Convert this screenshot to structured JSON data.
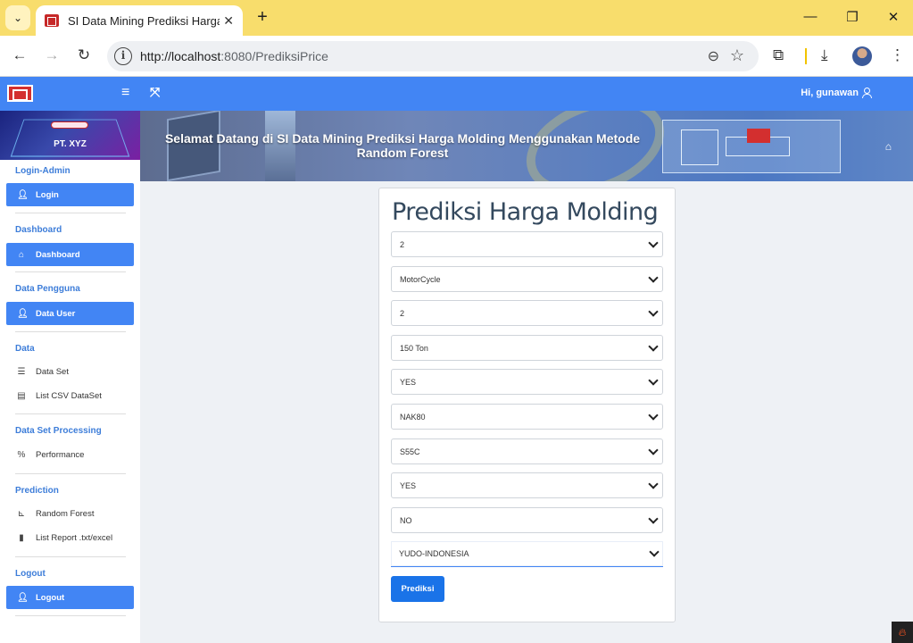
{
  "browser": {
    "tab_title": "SI Data Mining Prediksi Harga M",
    "tab_close": "✕",
    "new_tab": "+",
    "url_host": "http://localhost",
    "url_rest": ":8080/PrediksiPrice",
    "window_minimize": "—",
    "window_restore": "❐",
    "window_close": "✕"
  },
  "app": {
    "user_greeting": "Hi, gunawan",
    "company_name": "PT. XYZ",
    "hero_title": "Selamat Datang di SI Data Mining Prediksi Harga Molding Menggunakan Metode Random Forest"
  },
  "sidebar": {
    "sections": {
      "login_admin": "Login-Admin",
      "dashboard": "Dashboard",
      "data_pengguna": "Data Pengguna",
      "data": "Data",
      "processing": "Data Set Processing",
      "prediction": "Prediction",
      "logout": "Logout"
    },
    "items": {
      "login": "Login",
      "dashboard": "Dashboard",
      "data_user": "Data User",
      "data_set": "Data Set",
      "list_csv": "List CSV DataSet",
      "performance": "Performance",
      "random_forest": "Random Forest",
      "list_report": "List Report .txt/excel",
      "logout": "Logout"
    }
  },
  "form": {
    "title": "Prediksi Harga Molding",
    "selects": [
      "2",
      "MotorCycle",
      "2",
      "150 Ton",
      "YES",
      "NAK80",
      "S55C",
      "YES",
      "NO",
      "YUDO-INDONESIA"
    ],
    "submit_label": "Prediksi"
  }
}
